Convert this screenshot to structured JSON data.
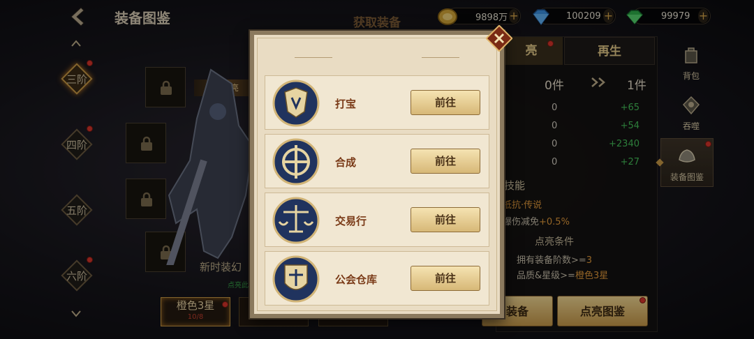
{
  "header": {
    "title": "装备图鉴",
    "currencies": [
      {
        "icon": "gold-coin-icon",
        "value": "9898万"
      },
      {
        "icon": "blue-diamond-icon",
        "value": "100209"
      },
      {
        "icon": "green-gem-icon",
        "value": "99979"
      }
    ]
  },
  "tiers": [
    {
      "label": "三阶",
      "active": true
    },
    {
      "label": "四阶",
      "active": false
    },
    {
      "label": "五阶",
      "active": false
    },
    {
      "label": "六阶",
      "active": false
    }
  ],
  "lit_tag": "可点亮",
  "new_label": "新时装幻",
  "small_green": "点亮此",
  "quality_tabs": [
    {
      "label": "橙色3星",
      "sub": "10/8"
    },
    {
      "label": "",
      "sub": "10/8"
    },
    {
      "label": "",
      "sub": "10/8"
    }
  ],
  "right_panel": {
    "tab_left": "亮",
    "tab_right": "再生",
    "count_left": "0件",
    "count_right": "1件",
    "stats": [
      {
        "a": "0",
        "b": "+65"
      },
      {
        "a": "0",
        "b": "+54"
      },
      {
        "a": "0",
        "b": "+2340"
      },
      {
        "a": "0",
        "b": "+27"
      }
    ],
    "skill_title": "技能",
    "skill_line1": "抵抗·传说",
    "skill_line2_prefix": "爆伤减免",
    "skill_line2_value": "+0.5%",
    "cond_title": "点亮条件",
    "cond1_prefix": "拥有装备阶数>=",
    "cond1_value": "3",
    "cond2_prefix": "品质&星级>=",
    "cond2_value": "橙色3星",
    "btn_left": "装备",
    "btn_right": "点亮图鉴"
  },
  "side_menu": [
    {
      "icon": "backpack-icon",
      "label": "背包"
    },
    {
      "icon": "devour-icon",
      "label": "吞噬"
    },
    {
      "icon": "equipment-atlas-icon",
      "label": "装备图鉴"
    }
  ],
  "modal": {
    "title": "获取装备",
    "sources": [
      {
        "icon": "treasure-hunt-emblem-icon",
        "label": "打宝",
        "button": "前往"
      },
      {
        "icon": "synthesis-emblem-icon",
        "label": "合成",
        "button": "前往"
      },
      {
        "icon": "trading-house-emblem-icon",
        "label": "交易行",
        "button": "前往"
      },
      {
        "icon": "guild-warehouse-emblem-icon",
        "label": "公会仓库",
        "button": "前往"
      }
    ]
  },
  "colors": {
    "accent_gold": "#e6cc8a",
    "stat_green": "#45c05a",
    "highlight_orange": "#e39a3b",
    "notify_red": "#d8352b"
  }
}
